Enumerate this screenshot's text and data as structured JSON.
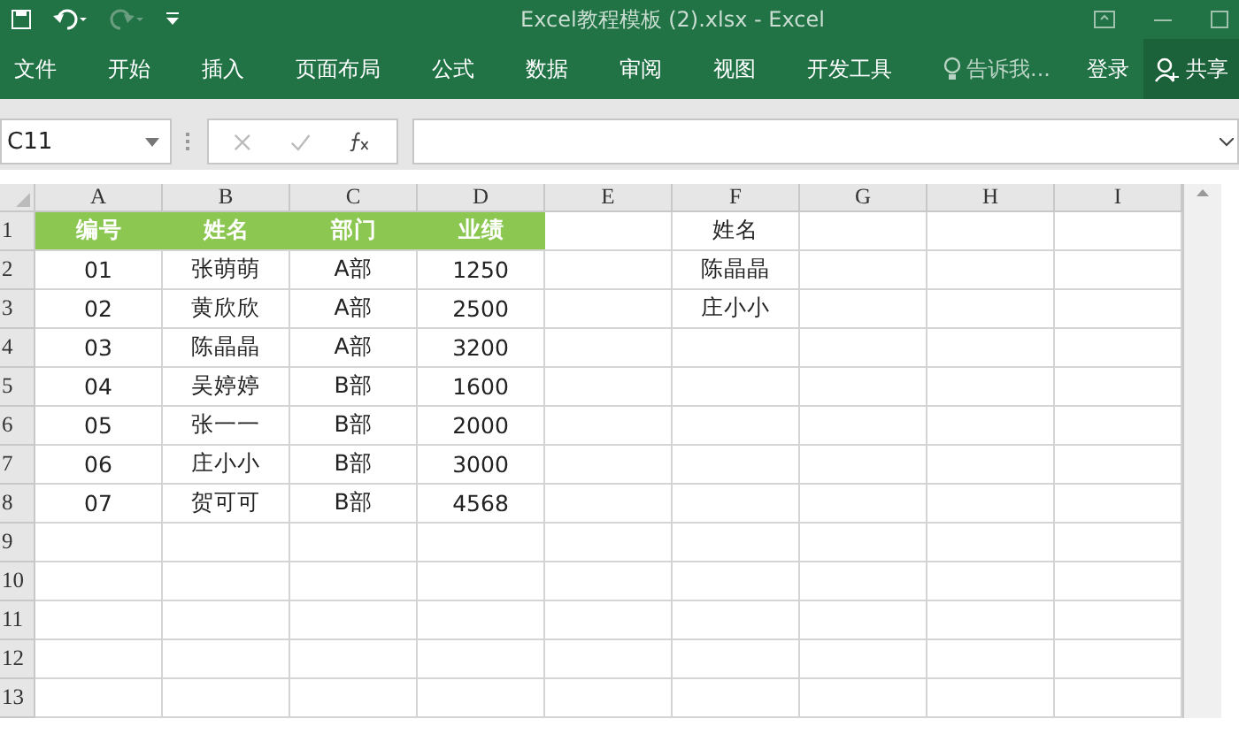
{
  "window": {
    "title": "Excel教程模板 (2).xlsx - Excel"
  },
  "ribbon": {
    "tabs": [
      {
        "label": "文件"
      },
      {
        "label": "开始"
      },
      {
        "label": "插入"
      },
      {
        "label": "页面布局"
      },
      {
        "label": "公式"
      },
      {
        "label": "数据"
      },
      {
        "label": "审阅"
      },
      {
        "label": "视图"
      },
      {
        "label": "开发工具"
      }
    ],
    "tell_me": "告诉我...",
    "login": "登录",
    "share": "共享"
  },
  "formula_bar": {
    "name_box": "C11"
  },
  "sheet": {
    "columns": [
      "A",
      "B",
      "C",
      "D",
      "E",
      "F",
      "G",
      "H",
      "I"
    ],
    "row_labels": [
      "1",
      "2",
      "3",
      "4",
      "5",
      "6",
      "7",
      "8",
      "9",
      "10",
      "11",
      "12",
      "13"
    ],
    "table": {
      "header": [
        "编号",
        "姓名",
        "部门",
        "业绩"
      ],
      "rows": [
        [
          "01",
          "张萌萌",
          "A部",
          "1250"
        ],
        [
          "02",
          "黄欣欣",
          "A部",
          "2500"
        ],
        [
          "03",
          "陈晶晶",
          "A部",
          "3200"
        ],
        [
          "04",
          "吴婷婷",
          "B部",
          "1600"
        ],
        [
          "05",
          "张一一",
          "B部",
          "2000"
        ],
        [
          "06",
          "庄小小",
          "B部",
          "3000"
        ],
        [
          "07",
          "贺可可",
          "B部",
          "4568"
        ]
      ]
    },
    "lookup": {
      "header": "姓名",
      "items": [
        "陈晶晶",
        "庄小小"
      ]
    }
  }
}
